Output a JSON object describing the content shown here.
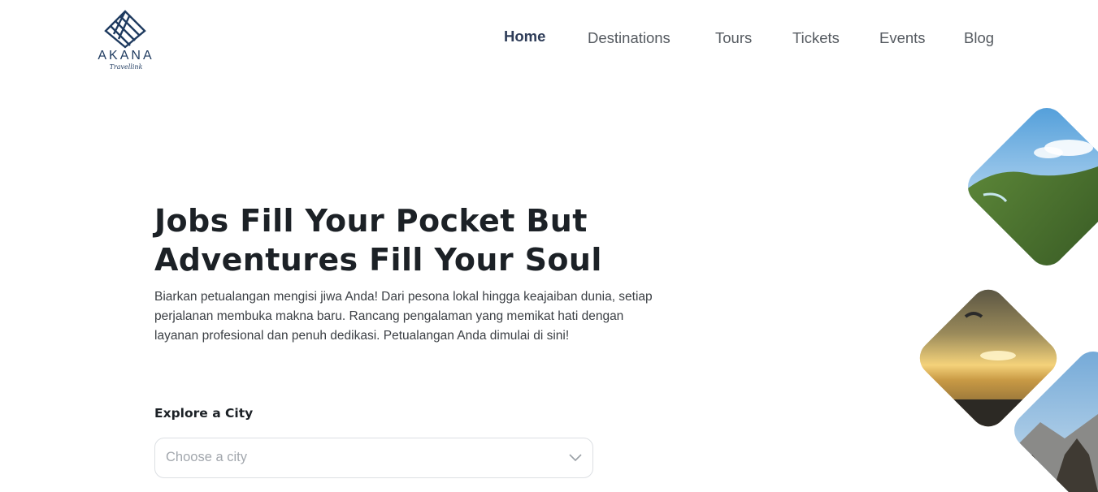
{
  "brand": {
    "name": "AKANA",
    "tagline": "Travellink",
    "color": "#1e3a5f"
  },
  "nav": {
    "items": [
      {
        "label": "Home",
        "active": true
      },
      {
        "label": "Destinations",
        "active": false
      },
      {
        "label": "Tours",
        "active": false
      },
      {
        "label": "Tickets",
        "active": false
      },
      {
        "label": "Events",
        "active": false
      },
      {
        "label": "Blog",
        "active": false
      }
    ]
  },
  "hero": {
    "title_line1": "Jobs Fill Your Pocket But",
    "title_line2": "Adventures Fill Your Soul",
    "description": "Biarkan petualangan mengisi jiwa Anda! Dari pesona lokal hingga keajaiban dunia, setiap perjalanan membuka makna baru. Rancang pengalaman yang memikat hati dengan layanan profesional dan penuh dedikasi. Petualangan Anda dimulai di sini!"
  },
  "explore": {
    "label": "Explore a City",
    "placeholder": "Choose a city",
    "chevron_icon": "chevron-down-icon"
  },
  "gallery": {
    "photos": [
      "hills-coast-photo",
      "paraglider-sunset-photo",
      "temple-stupa-photo"
    ]
  }
}
